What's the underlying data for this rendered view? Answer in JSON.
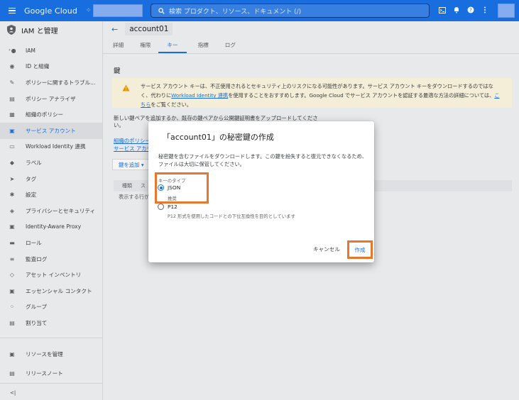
{
  "topbar": {
    "brand": "Google Cloud",
    "search_text": "検索  プロダクト、リソース、ドキュメント (/)"
  },
  "sidebar": {
    "header": "IAM と管理",
    "items": [
      {
        "label": "IAM",
        "icon": "person-add-icon"
      },
      {
        "label": "ID と組織",
        "icon": "account-circle-icon"
      },
      {
        "label": "ポリシーに関するトラブル...",
        "icon": "wrench-icon"
      },
      {
        "label": "ポリシー アナライザ",
        "icon": "document-search-icon"
      },
      {
        "label": "組織のポリシー",
        "icon": "policy-list-icon"
      },
      {
        "label": "サービス アカウント",
        "icon": "service-account-icon",
        "active": true
      },
      {
        "label": "Workload Identity 連携",
        "icon": "id-card-icon"
      },
      {
        "label": "ラベル",
        "icon": "label-icon"
      },
      {
        "label": "タグ",
        "icon": "tag-icon"
      },
      {
        "label": "設定",
        "icon": "gear-icon"
      },
      {
        "label": "プライバシーとセキュリティ",
        "icon": "shield-icon"
      },
      {
        "label": "Identity-Aware Proxy",
        "icon": "proxy-icon"
      },
      {
        "label": "ロール",
        "icon": "roles-icon"
      },
      {
        "label": "監査ログ",
        "icon": "list-icon"
      },
      {
        "label": "アセット インベントリ",
        "icon": "diamond-icon"
      },
      {
        "label": "エッセンシャル コンタクト",
        "icon": "contact-icon"
      },
      {
        "label": "グループ",
        "icon": "group-icon"
      },
      {
        "label": "割り当て",
        "icon": "quota-icon"
      }
    ],
    "bottom": [
      {
        "label": "リソースを管理",
        "icon": "folder-icon"
      },
      {
        "label": "リリースノート",
        "icon": "release-notes-icon"
      }
    ],
    "collapse": "<|"
  },
  "main": {
    "title": "account01",
    "tabs": [
      "詳細",
      "権限",
      "キー",
      "指標",
      "ログ"
    ],
    "active_tab": 2,
    "section_title": "鍵",
    "warning": {
      "line1": "サービス アカウント キーは、不正使用されるとセキュリティ上のリスクになる可能性があります。サービス アカウント キーをダウンロードするのではな",
      "line2_pre": "く、代わりに",
      "line2_link": "Workload Identity 連携",
      "line2_post": "を使用することをおすすめします。Google Cloud でサービス アカウントを認証する最適な方法の詳細については、",
      "line2_link2": "こ",
      "line3_link": "ちら",
      "line3_post": "をご覧ください。"
    },
    "paragraph": "新しい鍵ペアを追加するか、既存の鍵ペアから公開鍵証明書をアップロードしてください。",
    "link_org_policy": "組織のポリシー",
    "link_service_account": "サービス アカウ",
    "add_key_label": "鍵を追加 ▾",
    "table_headers": [
      "種類",
      "ス"
    ],
    "empty_text": "表示する行が"
  },
  "dialog": {
    "title": "「account01」の秘密鍵の作成",
    "body": "秘密鍵を含むファイルをダウンロードします。この鍵を紛失すると復元できなくなるため、ファイルは大切に保管してください。",
    "key_type_label": "キーのタイプ",
    "options": [
      {
        "label": "JSON",
        "sub": "推奨",
        "checked": true
      },
      {
        "label": "P12",
        "sub": "P12 形式を使用したコードとの下位互換性を目的としています",
        "checked": false
      }
    ],
    "cancel_label": "キャンセル",
    "create_label": "作成"
  },
  "colors": {
    "brand_blue": "#1a73e8",
    "highlight_orange": "#e8772e",
    "warning_bg": "#fef7e0"
  }
}
